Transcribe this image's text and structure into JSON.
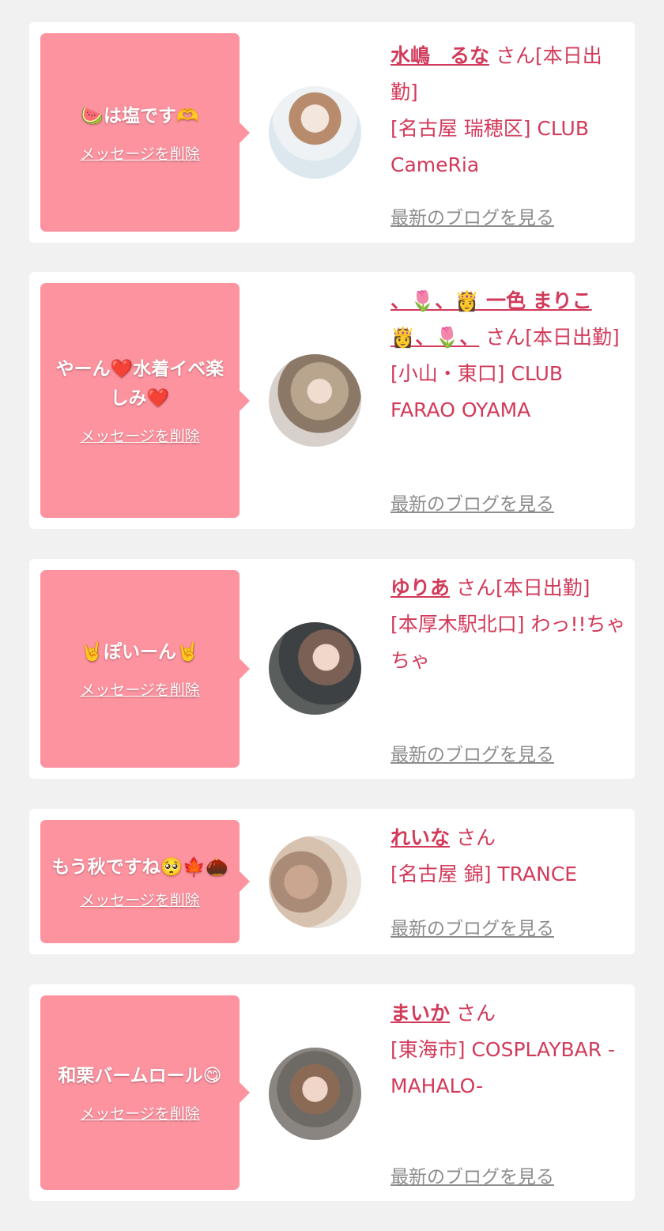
{
  "delete_label": "メッセージを削除",
  "blog_label": "最新のブログを見る",
  "cards": [
    {
      "message": "🍉は塩です🫶",
      "name": "水嶋　るな",
      "suffix": "さん[本日出勤]",
      "shop": "[名古屋 瑞穂区] CLUB CameRia"
    },
    {
      "message": "やーん❤️水着イベ楽しみ❤️",
      "name": "、🌷、👸 一色 まりこ 👸、🌷、",
      "suffix": "さん[本日出勤]",
      "shop": "[小山・東口] CLUB FARAO OYAMA"
    },
    {
      "message": "🤘ぽいーん🤘",
      "name": "ゆりあ",
      "suffix": "さん[本日出勤]",
      "shop": "[本厚木駅北口] わっ!!ちゃちゃ"
    },
    {
      "message": "もう秋ですね🥺🍁🌰",
      "name": "れいな",
      "suffix": "さん",
      "shop": "[名古屋 錦] TRANCE"
    },
    {
      "message": "和栗バームロール😋",
      "name": "まいか",
      "suffix": "さん",
      "shop": "[東海市] COSPLAYBAR -MAHALO-"
    }
  ]
}
